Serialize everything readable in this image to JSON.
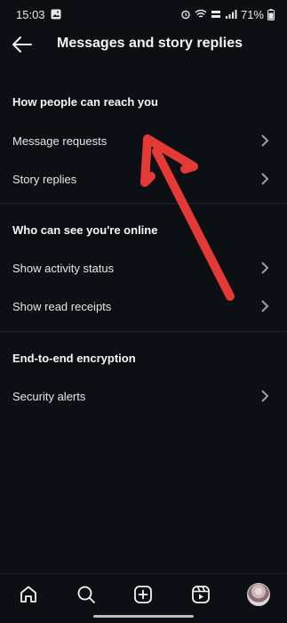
{
  "status_bar": {
    "time": "15:03",
    "battery": "71%"
  },
  "header": {
    "title": "Messages and story replies"
  },
  "sections": [
    {
      "heading": "How people can reach you",
      "items": [
        {
          "label": "Message requests"
        },
        {
          "label": "Story replies"
        }
      ]
    },
    {
      "heading": "Who can see you're online",
      "items": [
        {
          "label": "Show activity status"
        },
        {
          "label": "Show read receipts"
        }
      ]
    },
    {
      "heading": "End-to-end encryption",
      "items": [
        {
          "label": "Security alerts"
        }
      ]
    }
  ],
  "bottom_nav": {
    "items": [
      {
        "icon": "home-icon"
      },
      {
        "icon": "search-icon"
      },
      {
        "icon": "create-icon"
      },
      {
        "icon": "reels-icon"
      },
      {
        "icon": "profile-avatar"
      }
    ]
  },
  "colors": {
    "background": "#0c1014",
    "text": "#f5f5f5",
    "chevron": "#9aa0a6",
    "annotation_arrow": "#e53935"
  }
}
